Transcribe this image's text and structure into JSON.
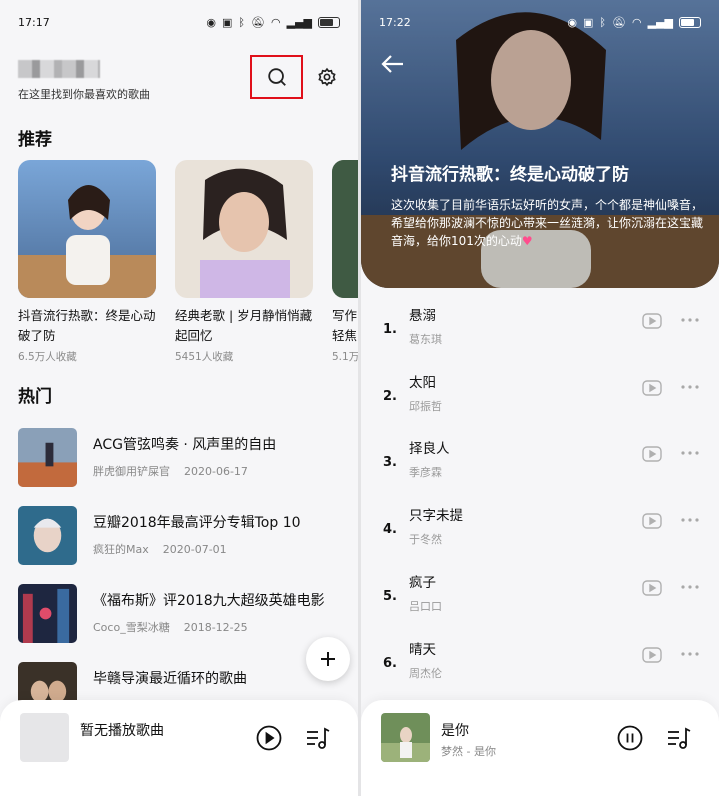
{
  "left": {
    "status_time": "17:17",
    "subtitle": "在这里找到你最喜欢的歌曲",
    "section_recommend": "推荐",
    "section_hot": "热门",
    "recommend": [
      {
        "title": "抖音流行热歌：终是心动破了防",
        "count": "6.5万人收藏"
      },
      {
        "title": "经典老歌 | 岁月静悄悄藏起回忆",
        "count": "5451人收藏"
      },
      {
        "title": "写作轻焦",
        "count": "5.1万"
      }
    ],
    "hot": [
      {
        "title": "ACG管弦鸣奏 · 风声里的自由",
        "author": "胖虎御用铲屎官",
        "date": "2020-06-17"
      },
      {
        "title": "豆瓣2018年最高评分专辑Top 10",
        "author": "疯狂的Max",
        "date": "2020-07-01"
      },
      {
        "title": "《福布斯》评2018九大超级英雄电影",
        "author": "Coco_雪梨冰糖",
        "date": "2018-12-25"
      },
      {
        "title": "毕赣导演最近循环的歌曲",
        "author": "",
        "date": ""
      }
    ],
    "player": {
      "title": "暂无播放歌曲"
    }
  },
  "right": {
    "status_time": "17:22",
    "playlist_title": "抖音流行热歌：终是心动破了防",
    "playlist_desc": "这次收集了目前华语乐坛好听的女声，个个都是神仙嗓音，希望给你那波澜不惊的心带来一丝涟漪，让你沉溺在这宝藏音海，给你101次的心动",
    "heart": "♥",
    "tracks": [
      {
        "num": "1.",
        "name": "悬溺",
        "artist": "葛东琪"
      },
      {
        "num": "2.",
        "name": "太阳",
        "artist": "邱振哲"
      },
      {
        "num": "3.",
        "name": "择良人",
        "artist": "季彦霖"
      },
      {
        "num": "4.",
        "name": "只字未提",
        "artist": "于冬然"
      },
      {
        "num": "5.",
        "name": "疯子",
        "artist": "吕口口"
      },
      {
        "num": "6.",
        "name": "晴天",
        "artist": "周杰伦"
      }
    ],
    "player": {
      "title": "是你",
      "artist": "梦然 - 是你"
    }
  },
  "colors": {
    "accent": "#e0101a",
    "background": "#f6f6f8",
    "heart": "#ff4d8d"
  },
  "icons": [
    "search-icon",
    "gear-icon",
    "plus-icon",
    "play-circle-icon",
    "pause-circle-icon",
    "playlist-icon",
    "back-arrow-icon",
    "mv-icon",
    "more-icon"
  ]
}
